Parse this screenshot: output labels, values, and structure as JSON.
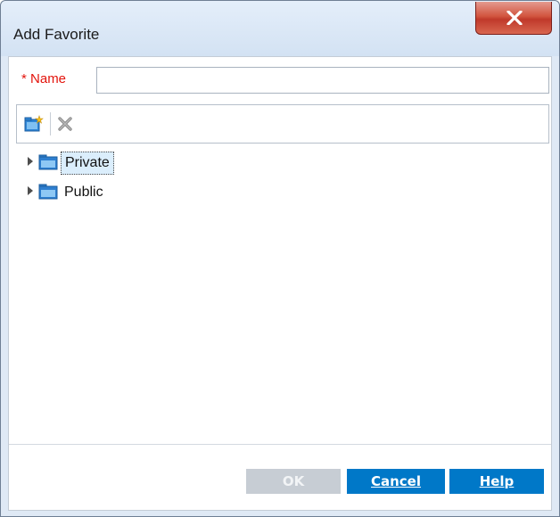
{
  "window": {
    "title": "Add Favorite",
    "close_glyph": "close-icon"
  },
  "name_field": {
    "required_marker": "*",
    "label": "Name",
    "value": "",
    "placeholder": ""
  },
  "toolbar": {
    "new_folder_icon": "new-folder-icon",
    "delete_icon": "delete-icon"
  },
  "tree": {
    "items": [
      {
        "label": "Private",
        "selected": true,
        "expanded": false
      },
      {
        "label": "Public",
        "selected": false,
        "expanded": false
      }
    ]
  },
  "buttons": {
    "ok": "OK",
    "cancel": "Cancel",
    "help": "Help"
  },
  "colors": {
    "required": "#e3140c",
    "primary_button": "#0078c8",
    "disabled_button": "#c7cdd4",
    "selection": "#dbeefc"
  }
}
